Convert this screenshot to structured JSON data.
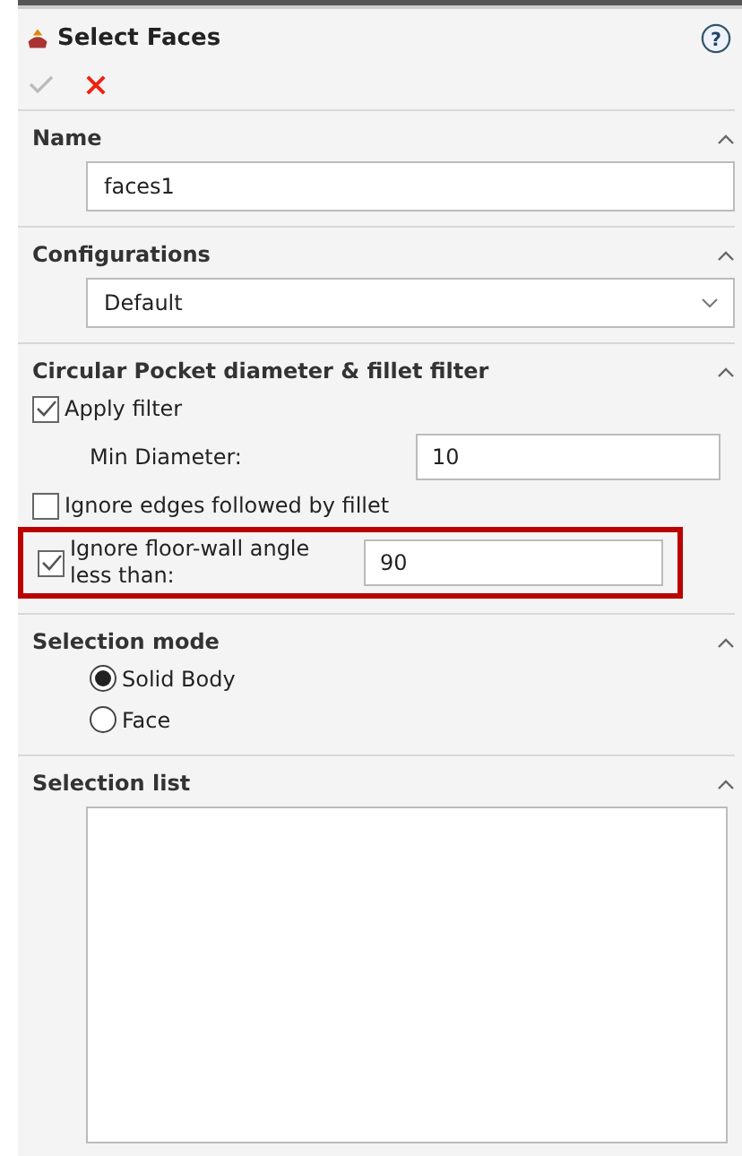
{
  "header": {
    "title": "Select Faces",
    "help": "?",
    "ok_enabled": false
  },
  "sections": [
    {
      "kind": "name",
      "title": "Name",
      "value": "faces1"
    },
    {
      "kind": "dropdown",
      "title": "Configurations",
      "value": "Default"
    },
    {
      "kind": "filter",
      "title": "Circular Pocket diameter & fillet filter",
      "rows": [
        {
          "kind": "checkbox",
          "label": "Apply filter",
          "checked": true
        },
        {
          "kind": "number",
          "label": "Min Diameter:",
          "value": "10"
        },
        {
          "kind": "checkbox",
          "label": "Ignore edges followed by fillet",
          "checked": false
        },
        {
          "kind": "checkbox-value",
          "label": "Ignore floor-wall angle less than:",
          "value": "90",
          "checked": true,
          "highlighted": true
        }
      ]
    },
    {
      "kind": "radio",
      "title": "Selection mode",
      "options": [
        {
          "label": "Solid Body",
          "selected": true
        },
        {
          "label": "Face",
          "selected": false
        }
      ]
    },
    {
      "kind": "list",
      "title": "Selection list"
    }
  ]
}
